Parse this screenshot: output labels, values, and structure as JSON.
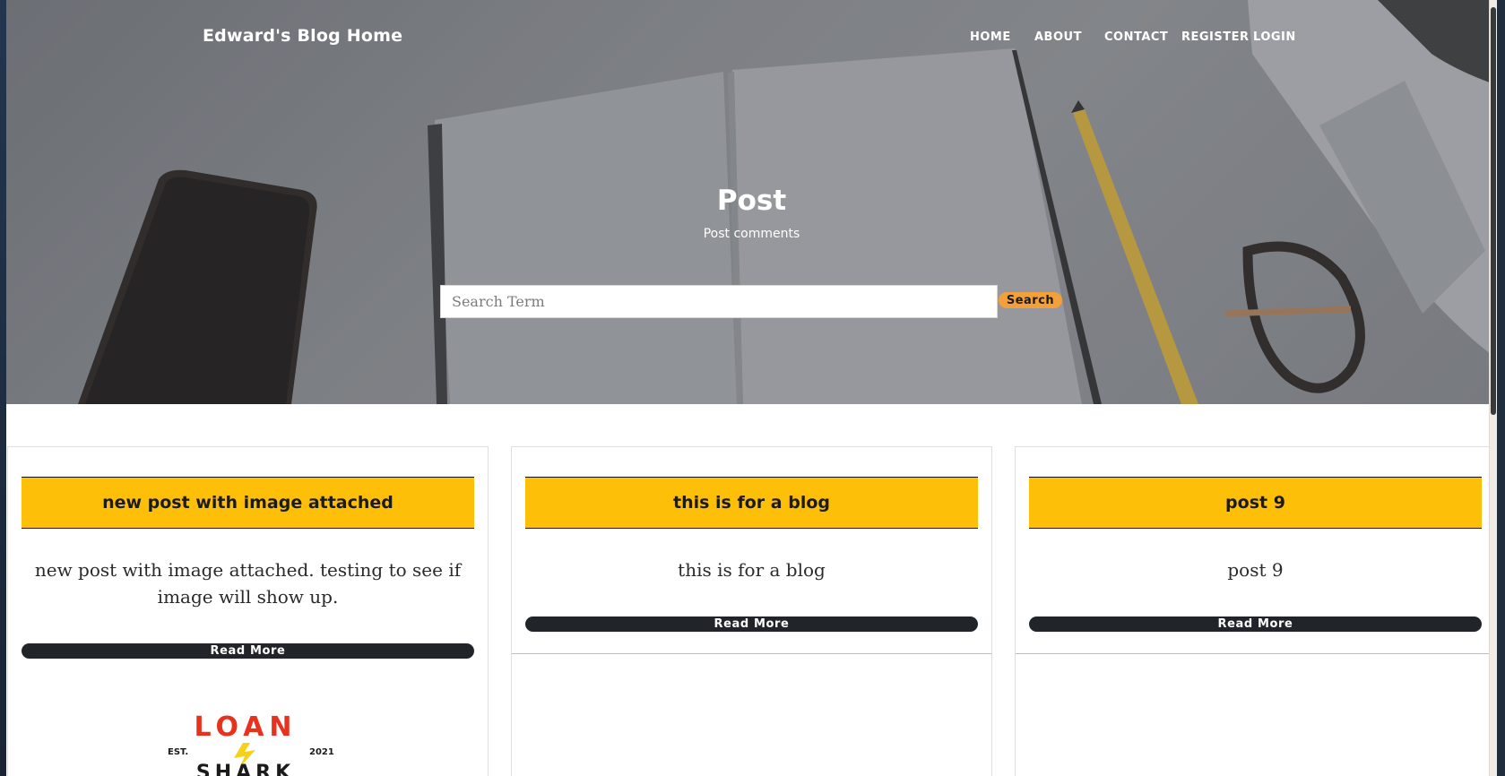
{
  "brand": {
    "title": "Edward's Blog Home"
  },
  "nav": {
    "items": [
      {
        "label": "HOME"
      },
      {
        "label": "ABOUT"
      },
      {
        "label": "CONTACT"
      },
      {
        "label": "REGISTER"
      },
      {
        "label": "LOGIN"
      }
    ]
  },
  "hero": {
    "title": "Post",
    "subtitle": "Post comments"
  },
  "search": {
    "placeholder": "Search Term",
    "value": "",
    "button_label": "Search"
  },
  "posts": [
    {
      "title": "new post with image attached",
      "body": "new post with image attached. testing to see if image will show up.",
      "read_more_label": "Read More",
      "image": {
        "brand_text": "LOAN",
        "est_left": "EST.",
        "est_right": "2021",
        "bottom_text": "SHARK"
      }
    },
    {
      "title": "this is for a blog",
      "body": "this is for a blog",
      "read_more_label": "Read More"
    },
    {
      "title": "post 9",
      "body": "post 9",
      "read_more_label": "Read More"
    }
  ],
  "colors": {
    "card_header": "#fdbf08",
    "search_button": "#f3a03b",
    "read_more": "#212529",
    "logo_red": "#e8321e",
    "logo_yellow": "#f4d21a"
  }
}
